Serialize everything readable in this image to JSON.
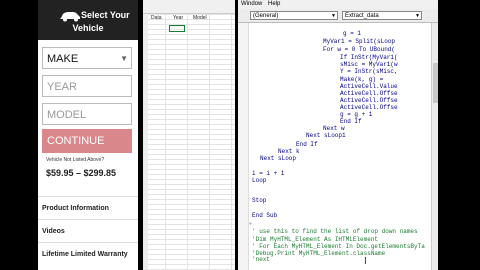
{
  "web": {
    "title_line1": "Select Your",
    "title_line2": "Vehicle",
    "make": "MAKE",
    "year": "YEAR",
    "model": "MODEL",
    "continue": "CONTINUE",
    "not_listed": "Vehicle Not Listed Above?",
    "price": "$59.95 – $299.85",
    "sections": [
      "Product Information",
      "Videos",
      "Lifetime Limited Warranty"
    ]
  },
  "sheet": {
    "columns": [
      "Data",
      "Year",
      "Model"
    ]
  },
  "vba": {
    "menu": [
      "Window",
      "Help"
    ],
    "object_combo": "(General)",
    "proc_combo": "Extract_data",
    "code_lines": [
      {
        "text": "g = 1",
        "color": "blue"
      },
      {
        "text": "MyVar1 = Split(sLoop",
        "color": "blue"
      },
      {
        "text": "For w = 0 To UBound(",
        "color": "blue"
      },
      {
        "text": "If InStr(MyVar1(",
        "color": "blue"
      },
      {
        "text": "sMisc = MyVar1(w",
        "color": "blue"
      },
      {
        "text": "Y = InStr(sMisc,",
        "color": "blue"
      },
      {
        "text": "Make(k, g) = ",
        "color": "blue"
      },
      {
        "text": "ActiveCell.Value",
        "color": "blue"
      },
      {
        "text": "ActiveCell.Offse",
        "color": "blue"
      },
      {
        "text": "ActiveCell.Offse",
        "color": "blue"
      },
      {
        "text": "ActiveCell.Offse",
        "color": "blue"
      },
      {
        "text": "g = g + 1",
        "color": "blue"
      },
      {
        "text": "End If",
        "color": "blue"
      },
      {
        "text": "Next w",
        "color": "blue"
      },
      {
        "text": "Next sLoop1",
        "color": "blue"
      },
      {
        "text": "End If",
        "color": "blue"
      },
      {
        "text": "Next k",
        "color": "blue"
      },
      {
        "text": "Next sLoop",
        "color": "blue"
      },
      {
        "text": "",
        "color": "blue"
      },
      {
        "text": "i = i + 1",
        "color": "blue"
      },
      {
        "text": "Loop",
        "color": "blue"
      },
      {
        "text": "",
        "color": "blue"
      },
      {
        "text": "Stop",
        "color": "blue"
      },
      {
        "text": "",
        "color": "blue"
      },
      {
        "text": "End Sub",
        "color": "blue"
      },
      {
        "text": "",
        "color": "blue"
      },
      {
        "text": "' use this to find the list of drop down names",
        "color": "green"
      },
      {
        "text": "'Dim MyHTML_Element As IHTMLElement",
        "color": "green"
      },
      {
        "text": "",
        "color": "green"
      },
      {
        "text": "' For Each MyHTML_Element In Doc.getElementsByTa",
        "color": "green"
      },
      {
        "text": "'Debug.Print MyHTML_Element.className",
        "color": "green"
      },
      {
        "text": "'next",
        "color": "green"
      }
    ]
  }
}
